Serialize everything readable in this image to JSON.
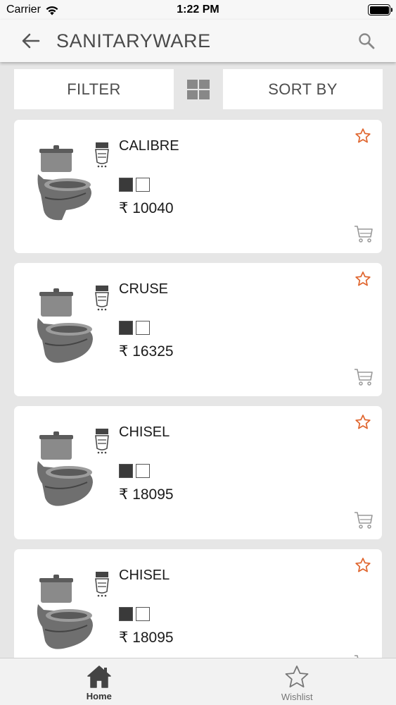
{
  "status_bar": {
    "carrier": "Carrier",
    "time": "1:22 PM"
  },
  "header": {
    "title": "SANITARYWARE",
    "back_icon": "arrow-left-icon",
    "search_icon": "search-icon"
  },
  "toolbar": {
    "filter_label": "FILTER",
    "view_icon": "grid-view-icon",
    "sort_label": "SORT BY"
  },
  "products": [
    {
      "name": "CALIBRE",
      "price": "₹ 10040",
      "swatches": [
        "#3a3a3a",
        "#ffffff"
      ]
    },
    {
      "name": "CRUSE",
      "price": "₹ 16325",
      "swatches": [
        "#3a3a3a",
        "#ffffff"
      ]
    },
    {
      "name": "CHISEL",
      "price": "₹ 18095",
      "swatches": [
        "#3a3a3a",
        "#ffffff"
      ]
    },
    {
      "name": "CHISEL",
      "price": "₹ 18095",
      "swatches": [
        "#3a3a3a",
        "#ffffff"
      ]
    }
  ],
  "tabs": [
    {
      "label": "Home",
      "icon": "home-icon",
      "active": true
    },
    {
      "label": "Wishlist",
      "icon": "star-icon",
      "active": false
    }
  ],
  "colors": {
    "accent_star": "#e0662f",
    "background": "#e6e6e6",
    "card": "#ffffff"
  }
}
